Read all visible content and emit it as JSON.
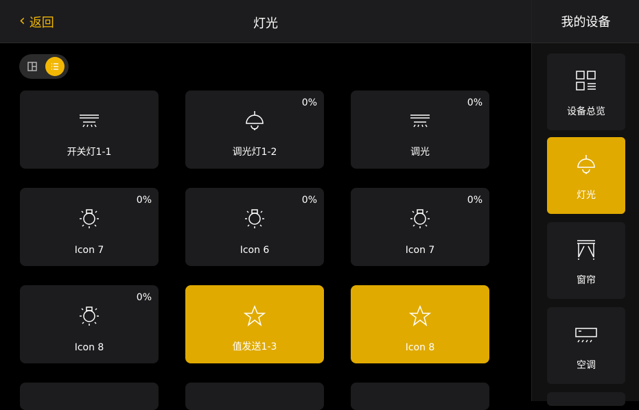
{
  "header": {
    "back_label": "返回",
    "title": "灯光"
  },
  "sidebar": {
    "title": "我的设备",
    "items": [
      {
        "label": "设备总览",
        "icon": "dashboard-icon",
        "active": false
      },
      {
        "label": "灯光",
        "icon": "pendant-lamp-icon",
        "active": true
      },
      {
        "label": "窗帘",
        "icon": "curtain-icon",
        "active": false
      },
      {
        "label": "空调",
        "icon": "air-conditioner-icon",
        "active": false
      }
    ]
  },
  "view_toggle": {
    "options": [
      {
        "icon": "grid-view-icon",
        "active": false
      },
      {
        "icon": "list-view-icon",
        "active": true
      }
    ]
  },
  "devices": [
    {
      "label": "开关灯1-1",
      "percent": "",
      "icon": "ceiling-light-icon",
      "active": false
    },
    {
      "label": "调光灯1-2",
      "percent": "0%",
      "icon": "pendant-lamp-icon",
      "active": false
    },
    {
      "label": "调光",
      "percent": "0%",
      "icon": "ceiling-light-icon",
      "active": false
    },
    {
      "label": "Icon 7",
      "percent": "0%",
      "icon": "light-bulb-icon",
      "active": false
    },
    {
      "label": "Icon 6",
      "percent": "0%",
      "icon": "light-bulb-icon",
      "active": false
    },
    {
      "label": "Icon 7",
      "percent": "0%",
      "icon": "light-bulb-icon",
      "active": false
    },
    {
      "label": "Icon 8",
      "percent": "0%",
      "icon": "light-bulb-icon",
      "active": false
    },
    {
      "label": "值发送1-3",
      "percent": "",
      "icon": "star-icon",
      "active": true
    },
    {
      "label": "Icon 8",
      "percent": "",
      "icon": "star-icon",
      "active": true
    }
  ],
  "colors": {
    "accent": "#e0aa00",
    "card": "#1c1c1e",
    "background": "#000000"
  }
}
